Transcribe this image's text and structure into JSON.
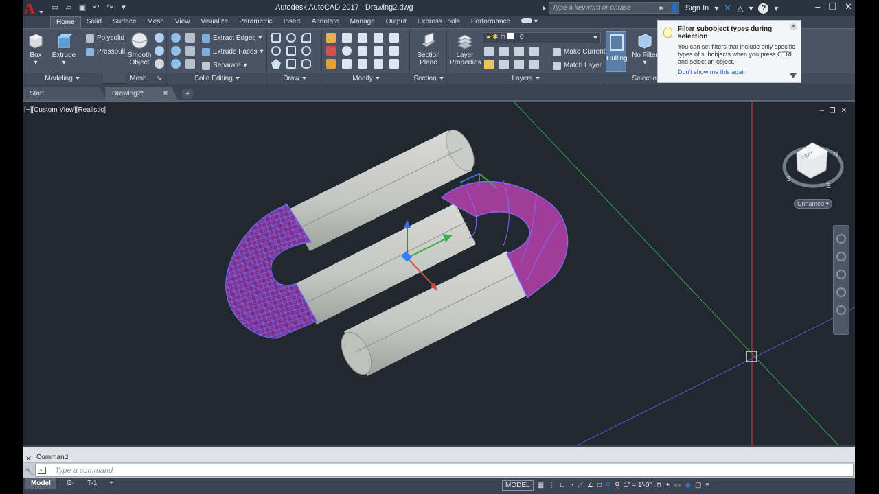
{
  "app": {
    "title": "Autodesk AutoCAD 2017",
    "document": "Drawing2.dwg",
    "logo_letter": "A"
  },
  "search": {
    "placeholder": "Type a keyword or phrase"
  },
  "account": {
    "sign_in": "Sign In"
  },
  "ribbon_tabs": [
    "Home",
    "Solid",
    "Surface",
    "Mesh",
    "View",
    "Visualize",
    "Parametric",
    "Insert",
    "Annotate",
    "Manage",
    "Output",
    "Express Tools",
    "Performance"
  ],
  "ribbon": {
    "modeling": {
      "title": "Modeling",
      "box": "Box",
      "extrude": "Extrude",
      "polysolid": "Polysolid",
      "presspull": "Presspull"
    },
    "mesh": {
      "title": "Mesh",
      "smooth_object_1": "Smooth",
      "smooth_object_2": "Object"
    },
    "solid_editing": {
      "title": "Solid Editing",
      "extract_edges": "Extract Edges",
      "extrude_faces": "Extrude Faces",
      "separate": "Separate"
    },
    "draw": {
      "title": "Draw"
    },
    "modify": {
      "title": "Modify"
    },
    "section": {
      "title": "Section",
      "section_plane_1": "Section",
      "section_plane_2": "Plane"
    },
    "layers": {
      "title": "Layers",
      "layer_properties_1": "Layer",
      "layer_properties_2": "Properties",
      "current_layer": "0",
      "make_current": "Make Current",
      "match_layer": "Match Layer"
    },
    "selection": {
      "title": "Selection",
      "culling": "Culling",
      "no_filter": "No Filter"
    }
  },
  "tooltip": {
    "title": "Filter subobject types during selection",
    "body": "You can set filters that include only specific types of subobjects when you press CTRL and select an object.",
    "link": "Don't show me this again"
  },
  "file_tabs": {
    "start": "Start",
    "doc": "Drawing2*"
  },
  "viewport": {
    "label": "[−][Custom View][Realistic]",
    "viewcube": {
      "face": "LEFT",
      "n": "N",
      "s": "S",
      "e": "E"
    },
    "ucs_name": "Unnamed"
  },
  "command": {
    "history": "Command:",
    "placeholder": "Type a command"
  },
  "layout_tabs": {
    "model": "Model",
    "g": "G-",
    "t": "T-1",
    "add": "+"
  },
  "status": {
    "model": "MODEL",
    "scale": "1\" = 1'-0\""
  },
  "colors": {
    "accent": "#2b7fd8",
    "logo": "#e01a22",
    "mesh_purple": "#a03a9a",
    "cylinder": "#c9cbc7"
  }
}
